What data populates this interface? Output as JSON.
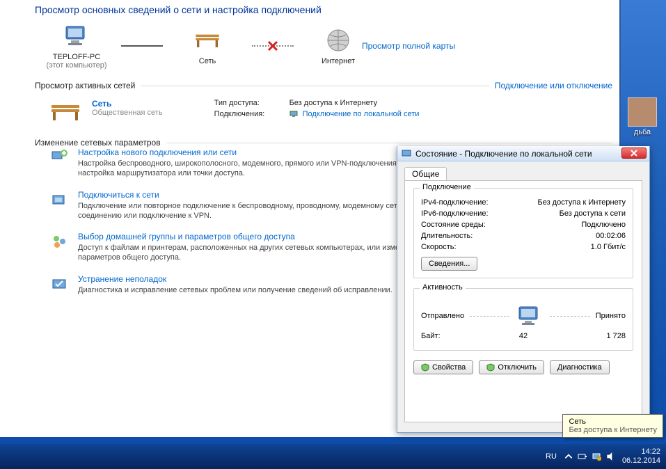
{
  "page": {
    "title": "Просмотр основных сведений о сети и настройка подключений",
    "view_full_map": "Просмотр полной карты"
  },
  "map": {
    "pc": "TEPLOFF-PC",
    "pc_sub": "(этот компьютер)",
    "network": "Сеть",
    "internet": "Интернет"
  },
  "active": {
    "section": "Просмотр активных сетей",
    "right_link": "Подключение или отключение",
    "name": "Сеть",
    "type": "Общественная сеть",
    "access_k": "Тип доступа:",
    "access_v": "Без доступа к Интернету",
    "conn_k": "Подключения:",
    "conn_v": "Подключение по локальной сети"
  },
  "settings": {
    "header": "Изменение сетевых параметров",
    "items": [
      {
        "title": "Настройка нового подключения или сети",
        "desc": "Настройка беспроводного, широкополосного, модемного, прямого или VPN-подключения или же настройка маршрутизатора или точки доступа."
      },
      {
        "title": "Подключиться к сети",
        "desc": "Подключение или повторное подключение к беспроводному, проводному, модемному сетевому соединению или подключение к VPN."
      },
      {
        "title": "Выбор домашней группы и параметров общего доступа",
        "desc": "Доступ к файлам и принтерам, расположенных на других сетевых компьютерах, или изменение параметров общего доступа."
      },
      {
        "title": "Устранение неполадок",
        "desc": "Диагностика и исправление сетевых проблем или получение сведений об исправлении."
      }
    ]
  },
  "status": {
    "title": "Состояние - Подключение по локальной сети",
    "tab": "Общие",
    "group_conn": "Подключение",
    "rows": {
      "ipv4_k": "IPv4-подключение:",
      "ipv4_v": "Без доступа к Интернету",
      "ipv6_k": "IPv6-подключение:",
      "ipv6_v": "Без доступа к сети",
      "media_k": "Состояние среды:",
      "media_v": "Подключено",
      "dur_k": "Длительность:",
      "dur_v": "00:02:06",
      "speed_k": "Скорость:",
      "speed_v": "1.0 Гбит/с"
    },
    "details_btn": "Сведения...",
    "group_act": "Активность",
    "sent": "Отправлено",
    "recv": "Принято",
    "bytes_k": "Байт:",
    "bytes_sent": "42",
    "bytes_recv": "1 728",
    "btn_props": "Свойства",
    "btn_disable": "Отключить",
    "btn_diag": "Диагностика"
  },
  "tooltip": {
    "line1": "Сеть",
    "line2": "Без доступа к Интернету"
  },
  "taskbar": {
    "lang": "RU",
    "time": "14:22",
    "date": "06.12.2014"
  },
  "desktop": {
    "icon_label": "дьба"
  }
}
